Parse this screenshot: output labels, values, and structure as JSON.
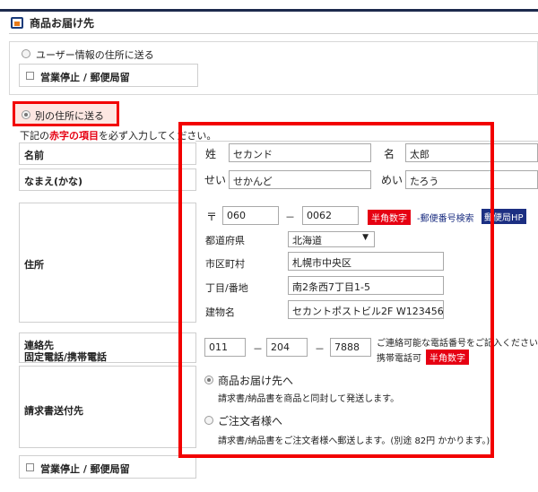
{
  "section": {
    "title": "商品お届け先"
  },
  "delivery_options": {
    "user_address": "ユーザー情報の住所に送る",
    "other_address": "別の住所に送る",
    "closed_checkbox": "営業停止 / 郵便局留"
  },
  "notice": {
    "prefix": "下記の",
    "highlight": "赤字の項目",
    "suffix": "を必ず入力してください。"
  },
  "name": {
    "label": "名前",
    "sei_label": "姓",
    "sei_value": "セカンド",
    "mei_label": "名",
    "mei_value": "太郎"
  },
  "kana": {
    "label": "なまえ(かな)",
    "sei_label": "せい",
    "sei_value": "せかんど",
    "mei_label": "めい",
    "mei_value": "たろう"
  },
  "address": {
    "label": "住所",
    "zip_mark": "〒",
    "zip1": "060",
    "zip_dash": "－",
    "zip2": "0062",
    "halfwidth_tag": "半角数字",
    "zip_search": "-郵便番号検索",
    "post_hp": "郵便局HP",
    "pref_label": "都道府県",
    "pref_value": "北海道",
    "city_label": "市区町村",
    "city_value": "札幌市中央区",
    "street_label": "丁目/番地",
    "street_value": "南2条西7丁目1-5",
    "building_label": "建物名",
    "building_value": "セカントポストビル2F W123456"
  },
  "phone": {
    "label_line1": "連絡先",
    "label_line2": "固定電話/携帯電話",
    "p1": "011",
    "dash": "－",
    "p2": "204",
    "p3": "7888",
    "note": "ご連絡可能な電話番号をご記入ください。",
    "note2": "携帯電話可",
    "halfwidth_tag": "半角数字"
  },
  "invoice": {
    "label": "請求書送付先",
    "opt1_label": "商品お届け先へ",
    "opt1_desc": "請求書/納品書を商品と同封して発送します。",
    "opt2_label": "ご注文者様へ",
    "opt2_desc": "請求書/納品書をご注文者様へ郵送します。(別途 82円 かかります。)"
  },
  "bottom": {
    "closed_checkbox": "営業停止 / 郵便局留"
  },
  "colors": {
    "accent_red": "#e60012",
    "navy": "#1c2f82",
    "highlight_border": "#f20000"
  }
}
